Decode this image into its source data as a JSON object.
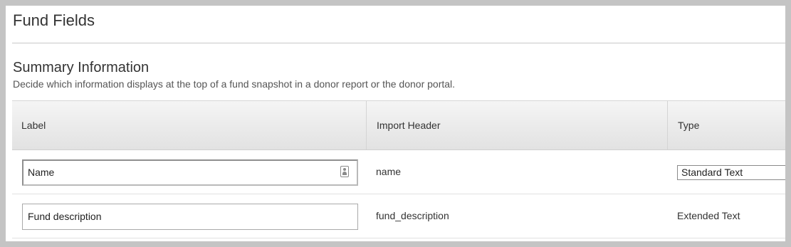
{
  "page": {
    "title": "Fund Fields"
  },
  "section": {
    "title": "Summary Information",
    "description": "Decide which information displays at the top of a fund snapshot in a donor report or the donor portal."
  },
  "table": {
    "columns": [
      "Label",
      "Import Header",
      "Type"
    ],
    "rows": [
      {
        "label_value": "Name",
        "import_header": "name",
        "type": "Standard Text",
        "type_is_select": true,
        "label_icon": "contact-card-icon"
      },
      {
        "label_value": "Fund description",
        "import_header": "fund_description",
        "type": "Extended Text",
        "type_is_select": false
      }
    ]
  }
}
